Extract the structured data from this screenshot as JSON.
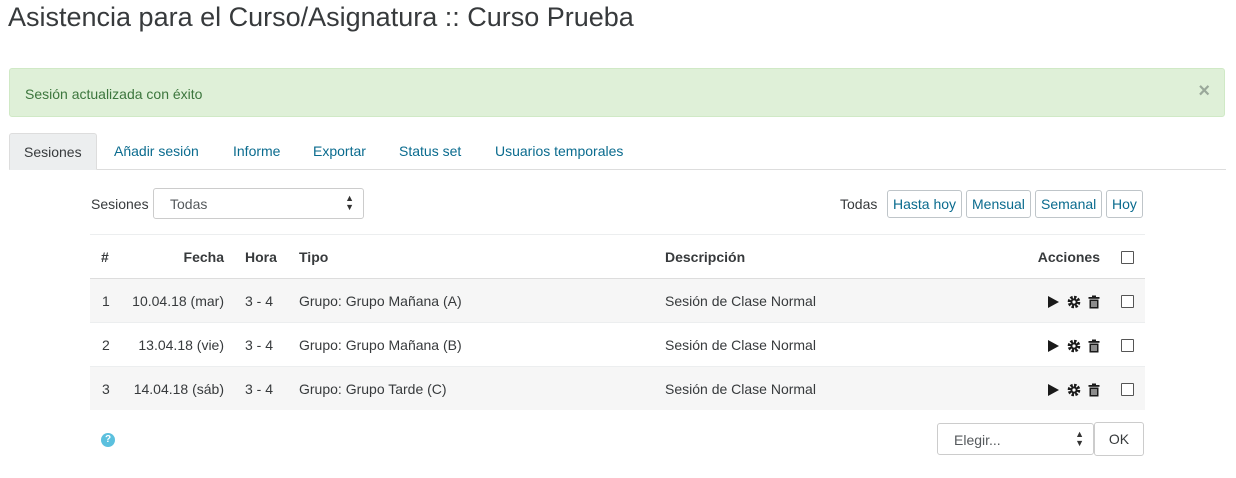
{
  "page": {
    "title": "Asistencia para el Curso/Asignatura :: Curso Prueba"
  },
  "alert": {
    "message": "Sesión actualizada con éxito",
    "close_symbol": "×"
  },
  "tabs": [
    {
      "label": "Sesiones",
      "active": true
    },
    {
      "label": "Añadir sesión"
    },
    {
      "label": "Informe"
    },
    {
      "label": "Exportar"
    },
    {
      "label": "Status set"
    },
    {
      "label": "Usuarios temporales"
    }
  ],
  "filters": {
    "sessions_label": "Sesiones",
    "sessions_select_value": "Todas",
    "view_label": "Todas",
    "buttons": [
      "Hasta hoy",
      "Mensual",
      "Semanal",
      "Hoy"
    ]
  },
  "table": {
    "headers": {
      "num": "#",
      "date": "Fecha",
      "time": "Hora",
      "type": "Tipo",
      "description": "Descripción",
      "actions": "Acciones"
    },
    "rows": [
      {
        "num": "1",
        "date": "10.04.18 (mar)",
        "time": "3 - 4",
        "type": "Grupo: Grupo Mañana (A)",
        "description": "Sesión de Clase Normal"
      },
      {
        "num": "2",
        "date": "13.04.18 (vie)",
        "time": "3 - 4",
        "type": "Grupo: Grupo Mañana (B)",
        "description": "Sesión de Clase Normal"
      },
      {
        "num": "3",
        "date": "14.04.18 (sáb)",
        "time": "3 - 4",
        "type": "Grupo: Grupo Tarde (C)",
        "description": "Sesión de Clase Normal"
      }
    ],
    "row_action_icons": [
      "play-icon",
      "gear-icon",
      "trash-icon"
    ]
  },
  "footer": {
    "bulk_select_value": "Elegir...",
    "ok_label": "OK",
    "help_symbol": "?"
  },
  "colors": {
    "link": "#0a6b8e",
    "alert_bg": "#dff0d8",
    "alert_text": "#3c763d",
    "help": "#5bc0de"
  }
}
